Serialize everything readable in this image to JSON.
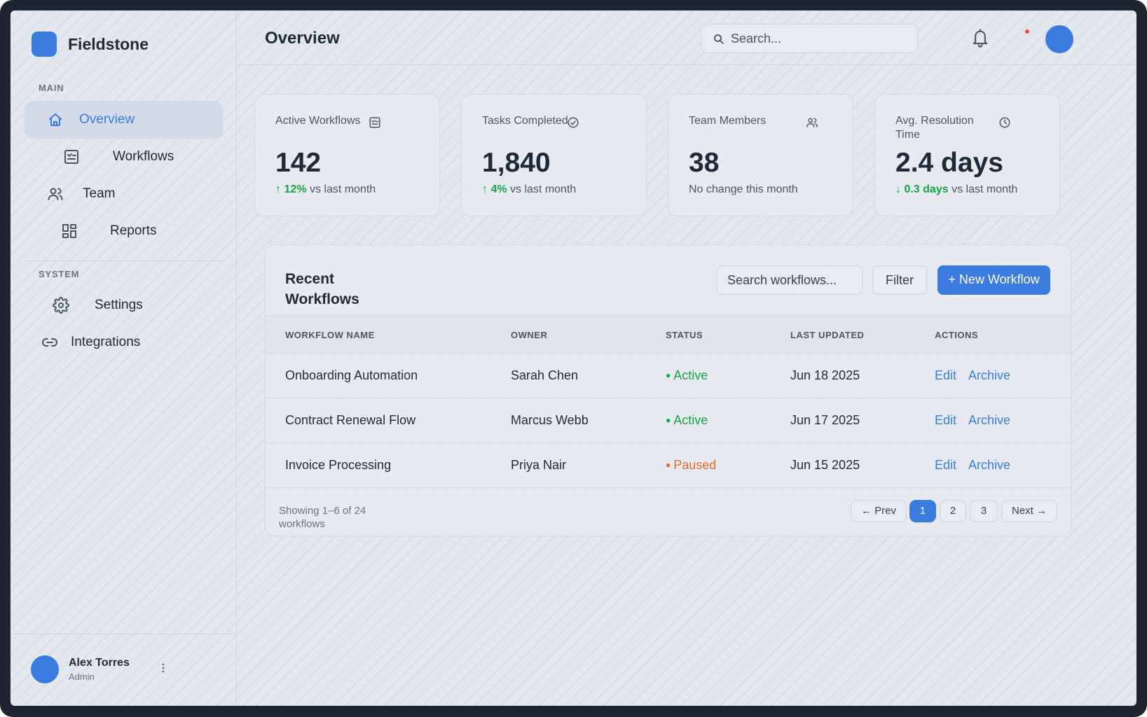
{
  "brand": {
    "name": "Fieldstone"
  },
  "sidebar": {
    "main_label": "MAIN",
    "system_label": "SYSTEM",
    "items": [
      {
        "label": "Overview",
        "icon": "home-icon",
        "active": true
      },
      {
        "label": "Workflows",
        "icon": "workflow-icon"
      },
      {
        "label": "Team",
        "icon": "team-icon"
      },
      {
        "label": "Reports",
        "icon": "grid-icon"
      }
    ],
    "system_items": [
      {
        "label": "Settings",
        "icon": "gear-icon"
      },
      {
        "label": "Integrations",
        "icon": "link-icon"
      }
    ],
    "user": {
      "name": "Alex Torres",
      "role": "Admin"
    }
  },
  "header": {
    "title": "Overview",
    "search_placeholder": "Search..."
  },
  "stats": [
    {
      "label": "Active Workflows",
      "value": "142",
      "delta_arrow": "↑",
      "delta": "12%",
      "delta_suffix": "vs last month",
      "icon": "workflow-icon"
    },
    {
      "label": "Tasks Completed",
      "value": "1,840",
      "delta_arrow": "↑",
      "delta": "4%",
      "delta_suffix": "vs last month",
      "icon": "check-circle-icon"
    },
    {
      "label": "Team Members",
      "value": "38",
      "delta_text": "No change this month",
      "icon": "team-icon"
    },
    {
      "label": "Avg. Resolution Time",
      "value": "2.4 days",
      "delta_arrow": "↓",
      "delta": "0.3 days",
      "delta_suffix": "vs last month",
      "icon": "clock-icon"
    }
  ],
  "workflows": {
    "title": "Recent Workflows",
    "search_placeholder": "Search workflows...",
    "filter_label": "Filter",
    "new_label": "+ New Workflow",
    "columns": [
      "WORKFLOW NAME",
      "OWNER",
      "STATUS",
      "LAST UPDATED",
      "ACTIONS"
    ],
    "rows": [
      {
        "name": "Onboarding Automation",
        "owner": "Sarah Chen",
        "status": "Active",
        "updated": "Jun 18 2025",
        "edit": "Edit",
        "archive": "Archive"
      },
      {
        "name": "Contract Renewal Flow",
        "owner": "Marcus Webb",
        "status": "Active",
        "updated": "Jun 17 2025",
        "edit": "Edit",
        "archive": "Archive"
      },
      {
        "name": "Invoice Processing",
        "owner": "Priya Nair",
        "status": "Paused",
        "updated": "Jun 15 2025",
        "edit": "Edit",
        "archive": "Archive"
      }
    ],
    "pagination": {
      "info": "Showing 1–6 of 24 workflows",
      "prev": "← Prev",
      "pages": [
        "1",
        "2",
        "3"
      ],
      "current": "1",
      "next": "Next →"
    }
  },
  "colors": {
    "accent": "#3b7be0",
    "active": "#16a34a",
    "paused": "#ea6a2a",
    "notification": "#ef4444"
  }
}
